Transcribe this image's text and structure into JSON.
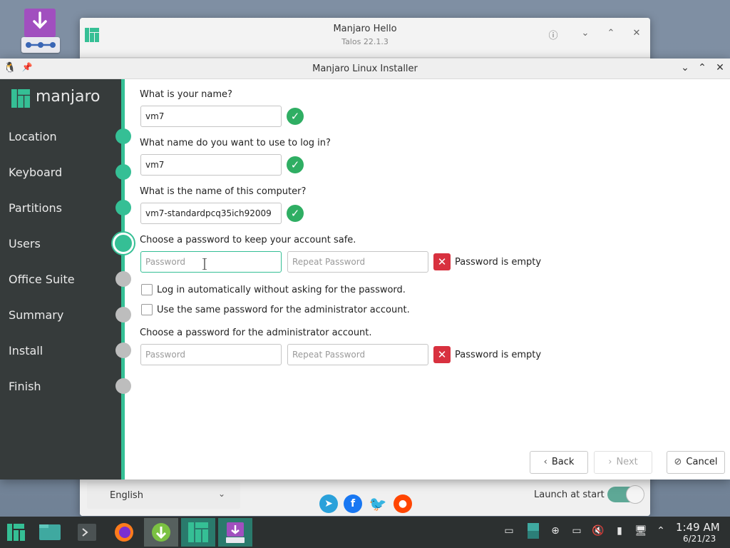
{
  "hello_window": {
    "title": "Manjaro Hello",
    "subtitle": "Talos 22.1.3",
    "language": "English",
    "launch_label": "Launch at start",
    "launch_enabled": true
  },
  "installer": {
    "title": "Manjaro Linux Installer",
    "brand": "manjaro",
    "steps": [
      {
        "label": "Location",
        "state": "done"
      },
      {
        "label": "Keyboard",
        "state": "done"
      },
      {
        "label": "Partitions",
        "state": "done"
      },
      {
        "label": "Users",
        "state": "current"
      },
      {
        "label": "Office Suite",
        "state": "todo"
      },
      {
        "label": "Summary",
        "state": "todo"
      },
      {
        "label": "Install",
        "state": "todo"
      },
      {
        "label": "Finish",
        "state": "todo"
      }
    ],
    "form": {
      "name_q": "What is your name?",
      "name_value": "vm7",
      "login_q": "What name do you want to use to log in?",
      "login_value": "vm7",
      "host_q": "What is the name of this computer?",
      "host_value": "vm7-standardpcq35ich92009",
      "pw_q": "Choose a password to keep your account safe.",
      "pw_placeholder": "Password",
      "pw_repeat_placeholder": "Repeat Password",
      "pw_error": "Password is empty",
      "autologin_label": "Log in automatically without asking for the password.",
      "samepw_label": "Use the same password for the administrator account.",
      "admin_q": "Choose a password for the administrator account.",
      "admin_pw_placeholder": "Password",
      "admin_pw_repeat_placeholder": "Repeat Password",
      "admin_pw_error": "Password is empty"
    },
    "buttons": {
      "back": "Back",
      "next": "Next",
      "cancel": "Cancel"
    }
  },
  "taskbar": {
    "clock_time": "1:49 AM",
    "clock_date": "6/21/23"
  },
  "colors": {
    "accent": "#35bf95",
    "sidebar": "#363b3b",
    "error": "#d8313f",
    "ok": "#2fae63"
  }
}
